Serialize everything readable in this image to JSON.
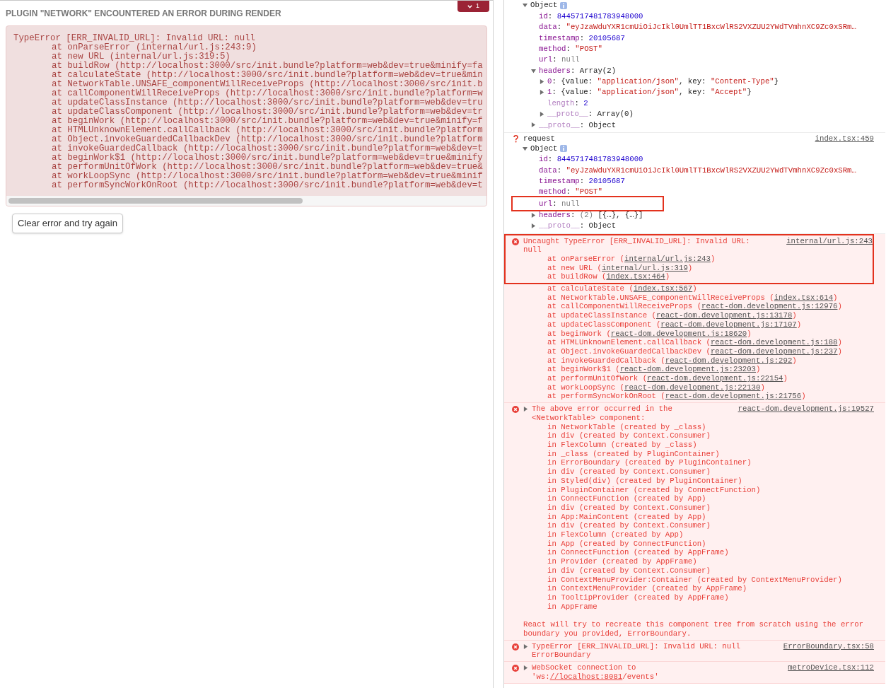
{
  "plugin_error": {
    "title": "PLUGIN \"NETWORK\" ENCOUNTERED AN ERROR DURING RENDER",
    "badge": {
      "count": "1"
    },
    "message": "TypeError [ERR_INVALID_URL]: Invalid URL: null",
    "frames": [
      "at onParseError (internal/url.js:243:9)",
      "at new URL (internal/url.js:319:5)",
      "at buildRow (http://localhost:3000/src/init.bundle?platform=web&dev=true&minify=fa",
      "at calculateState (http://localhost:3000/src/init.bundle?platform=web&dev=true&min",
      "at NetworkTable.UNSAFE_componentWillReceiveProps (http://localhost:3000/src/init.b",
      "at callComponentWillReceiveProps (http://localhost:3000/src/init.bundle?platform=w",
      "at updateClassInstance (http://localhost:3000/src/init.bundle?platform=web&dev=tru",
      "at updateClassComponent (http://localhost:3000/src/init.bundle?platform=web&dev=tr",
      "at beginWork (http://localhost:3000/src/init.bundle?platform=web&dev=true&minify=f",
      "at HTMLUnknownElement.callCallback (http://localhost:3000/src/init.bundle?platform",
      "at Object.invokeGuardedCallbackDev (http://localhost:3000/src/init.bundle?platform",
      "at invokeGuardedCallback (http://localhost:3000/src/init.bundle?platform=web&dev=t",
      "at beginWork$1 (http://localhost:3000/src/init.bundle?platform=web&dev=true&minify",
      "at performUnitOfWork (http://localhost:3000/src/init.bundle?platform=web&dev=true&",
      "at workLoopSync (http://localhost:3000/src/init.bundle?platform=web&dev=true&minif",
      "at performSyncWorkOnRoot (http://localhost:3000/src/init.bundle?platform=web&dev=t"
    ],
    "button": "Clear error and try again"
  },
  "console": {
    "entries": [
      {
        "kind": "log",
        "object": {
          "parts": [
            {
              "text": "Object",
              "kind": "plain"
            }
          ],
          "expanded": true,
          "children": [
            {
              "key": "id",
              "parts": [
                {
                  "text": ": ",
                  "kind": "plain"
                },
                {
                  "text": "8445717481783948000",
                  "kind": "number"
                }
              ]
            },
            {
              "key": "data",
              "parts": [
                {
                  "text": ": ",
                  "kind": "plain"
                },
                {
                  "text": "\"eyJzaWduYXR1cmUiOiJcIkl0UmlTT1BxcWlRS2VXZUU2YWdTVmhnXC9Zc0xSRm…",
                  "kind": "string"
                }
              ]
            },
            {
              "key": "timestamp",
              "parts": [
                {
                  "text": ": ",
                  "kind": "plain"
                },
                {
                  "text": "20105687",
                  "kind": "number"
                }
              ]
            },
            {
              "key": "method",
              "parts": [
                {
                  "text": ": ",
                  "kind": "plain"
                },
                {
                  "text": "\"POST\"",
                  "kind": "string"
                }
              ]
            },
            {
              "key": "url",
              "parts": [
                {
                  "text": ": ",
                  "kind": "plain"
                },
                {
                  "text": "null",
                  "kind": "null"
                }
              ]
            },
            {
              "key": "headers",
              "parts": [
                {
                  "text": ": ",
                  "kind": "plain"
                },
                {
                  "text": "Array(2)",
                  "kind": "plain"
                }
              ],
              "expanded": true,
              "children": [
                {
                  "key": "0",
                  "expanded": false,
                  "parts": [
                    {
                      "text": ": {value: ",
                      "kind": "plain"
                    },
                    {
                      "text": "\"application/json\"",
                      "kind": "string"
                    },
                    {
                      "text": ", key: ",
                      "kind": "plain"
                    },
                    {
                      "text": "\"Content-Type\"",
                      "kind": "string"
                    },
                    {
                      "text": "}",
                      "kind": "plain"
                    }
                  ]
                },
                {
                  "key": "1",
                  "expanded": false,
                  "parts": [
                    {
                      "text": ": {value: ",
                      "kind": "plain"
                    },
                    {
                      "text": "\"application/json\"",
                      "kind": "string"
                    },
                    {
                      "text": ", key: ",
                      "kind": "plain"
                    },
                    {
                      "text": "\"Accept\"",
                      "kind": "string"
                    },
                    {
                      "text": "}",
                      "kind": "plain"
                    }
                  ]
                },
                {
                  "key": "length",
                  "dim": true,
                  "parts": [
                    {
                      "text": ": ",
                      "kind": "plain"
                    },
                    {
                      "text": "2",
                      "kind": "number"
                    }
                  ]
                },
                {
                  "key": "__proto__",
                  "dim": true,
                  "expanded": false,
                  "parts": [
                    {
                      "text": ": ",
                      "kind": "plain"
                    },
                    {
                      "text": "Array(0)",
                      "kind": "plain"
                    }
                  ]
                }
              ]
            },
            {
              "key": "__proto__",
              "dim": true,
              "expanded": false,
              "parts": [
                {
                  "text": ": ",
                  "kind": "plain"
                },
                {
                  "text": "Object",
                  "kind": "plain"
                }
              ]
            }
          ]
        }
      },
      {
        "kind": "log",
        "message": [
          {
            "text": "request",
            "link": false
          }
        ],
        "source": "index.tsx:459",
        "object": {
          "parts": [
            {
              "text": "Object",
              "kind": "plain"
            }
          ],
          "expanded": true,
          "children": [
            {
              "key": "id",
              "parts": [
                {
                  "text": ": ",
                  "kind": "plain"
                },
                {
                  "text": "8445717481783948000",
                  "kind": "number"
                }
              ]
            },
            {
              "key": "data",
              "parts": [
                {
                  "text": ": ",
                  "kind": "plain"
                },
                {
                  "text": "\"eyJzaWduYXR1cmUiOiJcIkl0UmlTT1BxcWlRS2VXZUU2YWdTVmhnXC9Zc0xSRm…",
                  "kind": "string"
                }
              ]
            },
            {
              "key": "timestamp",
              "parts": [
                {
                  "text": ": ",
                  "kind": "plain"
                },
                {
                  "text": "20105687",
                  "kind": "number"
                }
              ]
            },
            {
              "key": "method",
              "parts": [
                {
                  "text": ": ",
                  "kind": "plain"
                },
                {
                  "text": "\"POST\"",
                  "kind": "string"
                }
              ]
            },
            {
              "key": "url",
              "parts": [
                {
                  "text": ": ",
                  "kind": "plain"
                },
                {
                  "text": "null",
                  "kind": "null"
                }
              ],
              "highlighted": true
            },
            {
              "key": "headers",
              "expanded": false,
              "parts": [
                {
                  "text": ": ",
                  "kind": "plain"
                },
                {
                  "text": "(2) ",
                  "kind": "null"
                },
                {
                  "text": "[{…}, {…}]",
                  "kind": "plain"
                }
              ]
            },
            {
              "key": "__proto__",
              "dim": true,
              "expanded": false,
              "parts": [
                {
                  "text": ": ",
                  "kind": "plain"
                },
                {
                  "text": "Object",
                  "kind": "plain"
                }
              ]
            }
          ]
        }
      },
      {
        "kind": "error",
        "message": [
          {
            "text": "Uncaught TypeError [ERR_INVALID_URL]: Invalid URL: null",
            "link": false
          }
        ],
        "source": "internal/url.js:243",
        "highlighted_frames": [
          {
            "prefix": "at onParseError (",
            "location": "internal/url.js:243",
            "suffix": ")"
          },
          {
            "prefix": "at new URL (",
            "location": "internal/url.js:319",
            "suffix": ")"
          },
          {
            "prefix": "at buildRow (",
            "location": "index.tsx:464",
            "suffix": ")"
          }
        ],
        "frames": [
          {
            "prefix": "at calculateState (",
            "location": "index.tsx:567",
            "suffix": ")"
          },
          {
            "prefix": "at NetworkTable.UNSAFE_componentWillReceiveProps (",
            "location": "index.tsx:614",
            "suffix": ")"
          },
          {
            "prefix": "at callComponentWillReceiveProps (",
            "location": "react-dom.development.js:12976",
            "suffix": ")"
          },
          {
            "prefix": "at updateClassInstance (",
            "location": "react-dom.development.js:13178",
            "suffix": ")"
          },
          {
            "prefix": "at updateClassComponent (",
            "location": "react-dom.development.js:17107",
            "suffix": ")"
          },
          {
            "prefix": "at beginWork (",
            "location": "react-dom.development.js:18620",
            "suffix": ")"
          },
          {
            "prefix": "at HTMLUnknownElement.callCallback (",
            "location": "react-dom.development.js:188",
            "suffix": ")"
          },
          {
            "prefix": "at Object.invokeGuardedCallbackDev (",
            "location": "react-dom.development.js:237",
            "suffix": ")"
          },
          {
            "prefix": "at invokeGuardedCallback (",
            "location": "react-dom.development.js:292",
            "suffix": ")"
          },
          {
            "prefix": "at beginWork$1 (",
            "location": "react-dom.development.js:23203",
            "suffix": ")"
          },
          {
            "prefix": "at performUnitOfWork (",
            "location": "react-dom.development.js:22154",
            "suffix": ")"
          },
          {
            "prefix": "at workLoopSync (",
            "location": "react-dom.development.js:22130",
            "suffix": ")"
          },
          {
            "prefix": "at performSyncWorkOnRoot (",
            "location": "react-dom.development.js:21756",
            "suffix": ")"
          }
        ]
      },
      {
        "kind": "error",
        "expanded": false,
        "message": [
          {
            "text": "The above error occurred in the <NetworkTable> component:",
            "link": false
          }
        ],
        "source": "react-dom.development.js:19527",
        "lines": [
          "in NetworkTable (created by _class)",
          "in div (created by Context.Consumer)",
          "in FlexColumn (created by _class)",
          "in _class (created by PluginContainer)",
          "in ErrorBoundary (created by PluginContainer)",
          "in div (created by Context.Consumer)",
          "in Styled(div) (created by PluginContainer)",
          "in PluginContainer (created by ConnectFunction)",
          "in ConnectFunction (created by App)",
          "in div (created by Context.Consumer)",
          "in App:MainContent (created by App)",
          "in div (created by Context.Consumer)",
          "in FlexColumn (created by App)",
          "in App (created by ConnectFunction)",
          "in ConnectFunction (created by AppFrame)",
          "in Provider (created by AppFrame)",
          "in div (created by Context.Consumer)",
          "in ContextMenuProvider:Container (created by ContextMenuProvider)",
          "in ContextMenuProvider (created by AppFrame)",
          "in TooltipProvider (created by AppFrame)",
          "in AppFrame"
        ],
        "note": "React will try to recreate this component tree from scratch using the error boundary you provided, ErrorBoundary."
      },
      {
        "kind": "error",
        "expanded": false,
        "message": [
          {
            "text": "TypeError [ERR_INVALID_URL]: Invalid URL: null ErrorBoundary",
            "link": false
          }
        ],
        "source": "ErrorBoundary.tsx:58"
      },
      {
        "kind": "error",
        "expanded": false,
        "message": [
          {
            "text": "WebSocket connection to 'ws:",
            "link": false
          },
          {
            "text": "//localhost:8081",
            "link": true
          },
          {
            "text": "/events'",
            "link": false
          }
        ],
        "source": "metroDevice.tsx:112"
      }
    ]
  }
}
